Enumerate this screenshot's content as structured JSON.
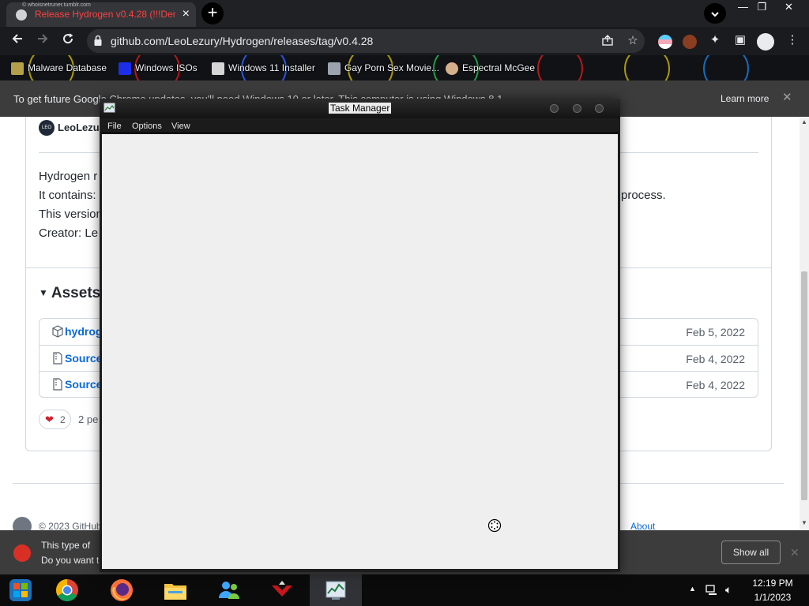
{
  "browser": {
    "tab": {
      "title": "Release Hydrogen v0.4.28 (!!!Dem",
      "watermark": "© whoisnetruner.tumblr.com",
      "close": "×"
    },
    "new_tab_symbol": "+",
    "window_controls": {
      "minimize": "—",
      "restore": "❐",
      "close": "✕"
    },
    "url": {
      "host": "github.com",
      "path": "/LeoLezury/Hydrogen/releases/tag/v0.4.28"
    },
    "bookmarks": [
      {
        "label": "Malware Database",
        "icon": "bookmark-folder-icon"
      },
      {
        "label": "Windows ISOs",
        "icon": "x-logo-icon"
      },
      {
        "label": "Windows 11 Installer",
        "icon": "installer-icon"
      },
      {
        "label": "Gay Porn Sex Movie...",
        "icon": "site-favicon"
      },
      {
        "label": "Espectral McGee",
        "icon": "site-favicon"
      }
    ],
    "info_bar": {
      "message": "To get future Google Chrome updates, you'll need Windows 10 or later. This computer is using Windows 8.1.",
      "action": "Learn more",
      "close": "✕"
    },
    "download_bar": {
      "line1": "This type of",
      "line2": "Do you want t",
      "show_all": "Show all",
      "close": "✕"
    }
  },
  "page": {
    "author": {
      "avatar_text": "LEO",
      "name": "LeoLezu"
    },
    "body_lines": [
      "Hydrogen r",
      "It contains:",
      "This version",
      "Creator: Le"
    ],
    "body_tail": "process.",
    "assets": {
      "heading": "Assets",
      "items": [
        {
          "name": "hydrog",
          "date": "Feb 5, 2022",
          "icon": "package-icon"
        },
        {
          "name": "Source",
          "date": "Feb 4, 2022",
          "icon": "zip-file-icon"
        },
        {
          "name": "Source",
          "date": "Feb 4, 2022",
          "icon": "zip-file-icon"
        }
      ]
    },
    "reactions": {
      "emoji": "❤",
      "count": "2",
      "people": "2 pe"
    },
    "footer": {
      "copyright": "© 2023 GitHub",
      "about": "About"
    }
  },
  "task_manager": {
    "title": "Task Manager",
    "menus": [
      "File",
      "Options",
      "View"
    ]
  },
  "taskbar": {
    "apps": [
      {
        "name": "Chrome",
        "icon": "chrome-icon"
      },
      {
        "name": "Firefox",
        "icon": "firefox-icon"
      },
      {
        "name": "File Explorer",
        "icon": "folder-icon"
      },
      {
        "name": "Messenger",
        "icon": "people-icon"
      },
      {
        "name": "Shield",
        "icon": "shield-icon"
      },
      {
        "name": "Task Manager",
        "icon": "task-manager-icon"
      }
    ],
    "time": "12:19 PM",
    "date": "1/1/2023"
  },
  "colors": {
    "tab_title": "#ff4040",
    "link_blue": "#0969da",
    "chrome_dark": "#202124"
  }
}
